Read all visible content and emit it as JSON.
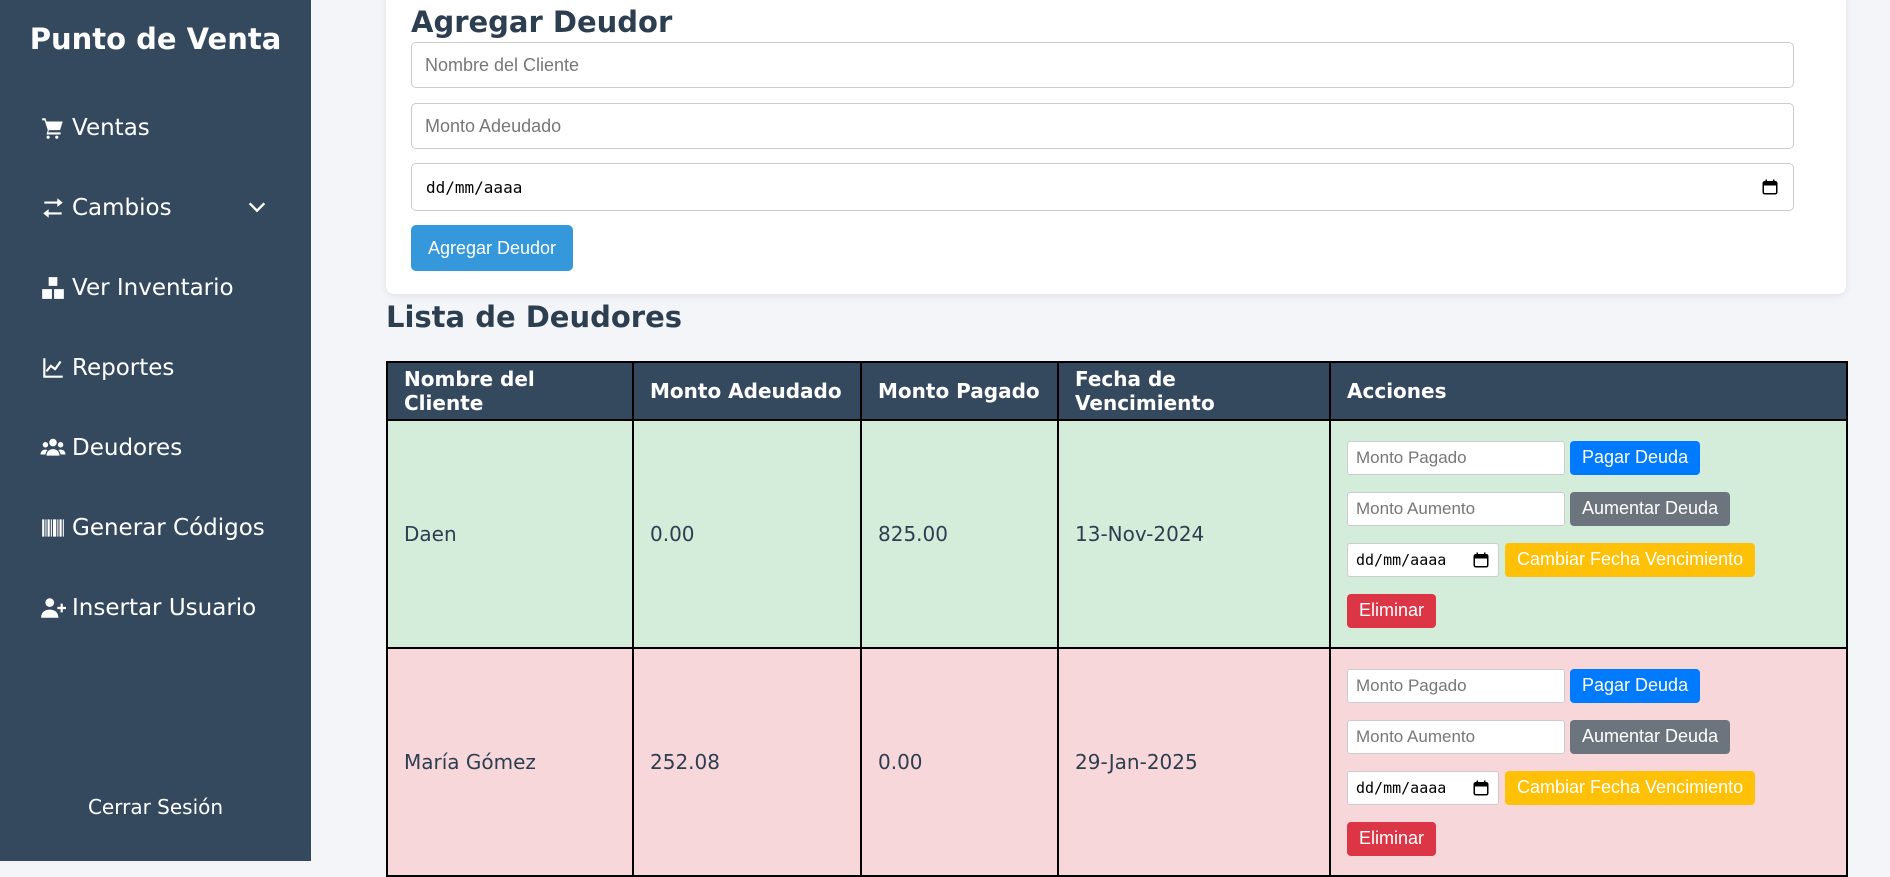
{
  "sidebar": {
    "brand": "Punto de Venta",
    "items": [
      {
        "label": "Ventas",
        "icon": "cart-icon"
      },
      {
        "label": "Cambios",
        "icon": "exchange-icon"
      },
      {
        "label": "Ver Inventario",
        "icon": "boxes-icon"
      },
      {
        "label": "Reportes",
        "icon": "chart-line-icon"
      },
      {
        "label": "Deudores",
        "icon": "users-icon"
      },
      {
        "label": "Generar Códigos",
        "icon": "barcode-icon"
      },
      {
        "label": "Insertar Usuario",
        "icon": "user-plus-icon"
      }
    ],
    "logout": "Cerrar Sesión"
  },
  "form": {
    "title": "Agregar Deudor",
    "name_placeholder": "Nombre del Cliente",
    "amount_placeholder": "Monto Adeudado",
    "date_placeholder": "dd/mm/aaaa",
    "submit_label": "Agregar Deudor"
  },
  "list": {
    "title": "Lista de Deudores",
    "columns": [
      "Nombre del Cliente",
      "Monto Adeudado",
      "Monto Pagado",
      "Fecha de Vencimiento",
      "Acciones"
    ],
    "rows": [
      {
        "name": "Daen",
        "owed": "0.00",
        "paid": "825.00",
        "due": "13-Nov-2024",
        "status": "paid"
      },
      {
        "name": "María Gómez",
        "owed": "252.08",
        "paid": "0.00",
        "due": "29-Jan-2025",
        "status": "owed"
      }
    ],
    "actions": {
      "paid_placeholder": "Monto Pagado",
      "pay_label": "Pagar Deuda",
      "increase_placeholder": "Monto Aumento",
      "increase_label": "Aumentar Deuda",
      "date_placeholder": "dd/mm/aaaa",
      "change_date_label": "Cambiar Fecha Vencimiento",
      "delete_label": "Eliminar"
    }
  },
  "colors": {
    "sidebar": "#34495e",
    "paid_row": "#d4edda",
    "owed_row": "#f8d7da",
    "primary": "#3498db"
  }
}
